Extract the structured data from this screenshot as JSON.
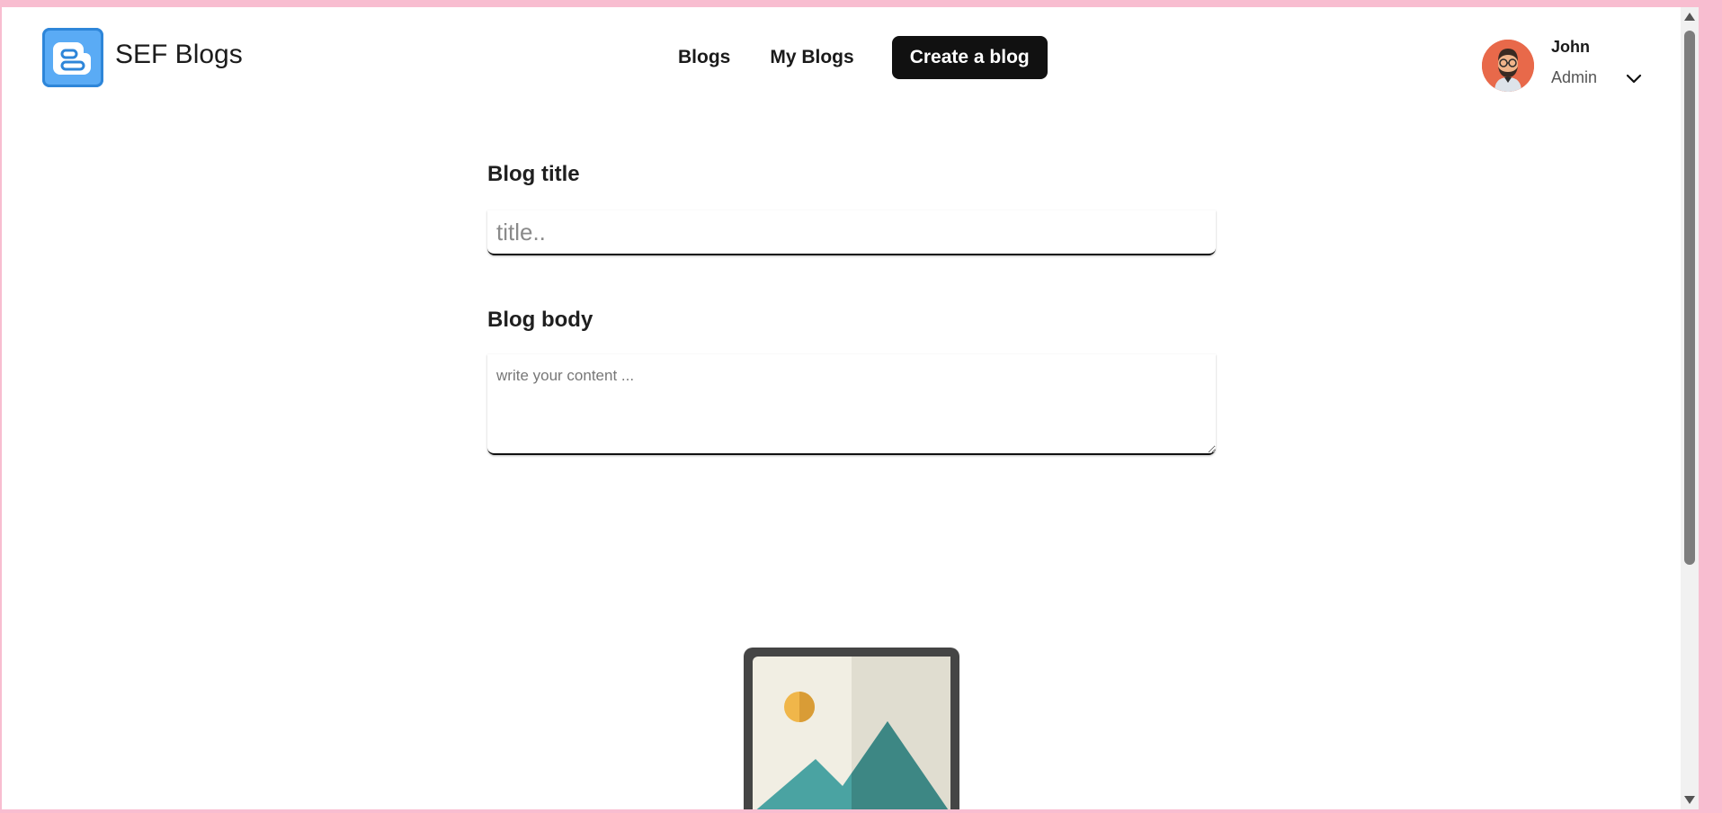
{
  "header": {
    "brand": "SEF Blogs",
    "nav": {
      "blogs": "Blogs",
      "my_blogs": "My Blogs",
      "create": "Create a blog"
    },
    "user": {
      "name": "John",
      "role": "Admin"
    }
  },
  "form": {
    "title_label": "Blog title",
    "title_placeholder": "title..",
    "title_value": "",
    "body_label": "Blog body",
    "body_placeholder": "write your content ...",
    "body_value": ""
  },
  "icons": {
    "logo": "blogger-logo-icon",
    "avatar": "user-avatar",
    "chevron": "chevron-down-icon",
    "image": "image-placeholder-icon"
  },
  "colors": {
    "accent": "#111111",
    "logo": "#5aabf5",
    "avatar_bg": "#e8694a",
    "page_border": "#f8bdd0"
  }
}
